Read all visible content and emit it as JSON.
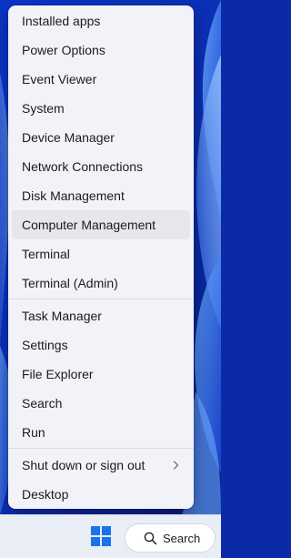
{
  "menu": {
    "group1": [
      {
        "label": "Installed apps"
      },
      {
        "label": "Power Options"
      },
      {
        "label": "Event Viewer"
      },
      {
        "label": "System"
      },
      {
        "label": "Device Manager"
      },
      {
        "label": "Network Connections"
      },
      {
        "label": "Disk Management"
      },
      {
        "label": "Computer Management"
      },
      {
        "label": "Terminal"
      },
      {
        "label": "Terminal (Admin)"
      }
    ],
    "group2": [
      {
        "label": "Task Manager"
      },
      {
        "label": "Settings"
      },
      {
        "label": "File Explorer"
      },
      {
        "label": "Search"
      },
      {
        "label": "Run"
      }
    ],
    "group3": [
      {
        "label": "Shut down or sign out"
      },
      {
        "label": "Desktop"
      }
    ],
    "hovered_item": "Computer Management"
  },
  "taskbar": {
    "search_label": "Search",
    "start_icon": "windows-logo-icon",
    "search_icon": "search-icon"
  },
  "colors": {
    "accent": "#1a73e8",
    "menu_bg": "#f2f3f8",
    "wallpaper": "#0a2aa8"
  }
}
